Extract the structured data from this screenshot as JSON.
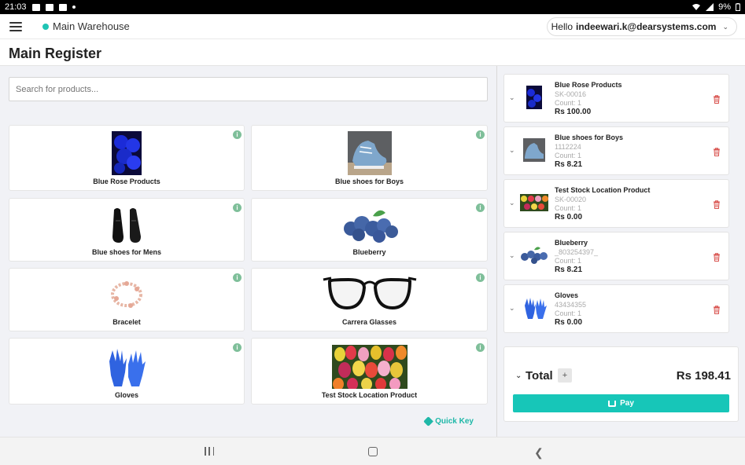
{
  "status_bar": {
    "time": "21:03",
    "battery": "9%"
  },
  "header": {
    "location": "Main Warehouse",
    "greeting": "Hello",
    "user": "indeewari.k@dearsystems.com"
  },
  "page": {
    "title": "Main Register"
  },
  "search": {
    "placeholder": "Search for products..."
  },
  "products": [
    {
      "name": "Blue Rose Products"
    },
    {
      "name": "Blue shoes for Boys"
    },
    {
      "name": "Blue shoes for Mens"
    },
    {
      "name": "Blueberry"
    },
    {
      "name": "Bracelet"
    },
    {
      "name": "Carrera Glasses"
    },
    {
      "name": "Gloves"
    },
    {
      "name": "Test Stock Location Product"
    }
  ],
  "quick_key": "Quick Key",
  "info_icon_glyph": "i",
  "cart": {
    "items": [
      {
        "name": "Blue Rose Products",
        "sku": "SK-00016",
        "count": "Count: 1",
        "price": "Rs 100.00"
      },
      {
        "name": "Blue shoes for Boys",
        "sku": "1112224",
        "count": "Count: 1",
        "price": "Rs 8.21"
      },
      {
        "name": "Test Stock Location Product",
        "sku": "SK-00020",
        "count": "Count: 1",
        "price": "Rs 0.00"
      },
      {
        "name": "Blueberry",
        "sku": "_803254397_",
        "count": "Count: 1",
        "price": "Rs 8.21"
      },
      {
        "name": "Gloves",
        "sku": "43434355",
        "count": "Count: 1",
        "price": "Rs 0.00"
      }
    ],
    "total_label": "Total",
    "total_plus": "+",
    "total_amount": "Rs 198.41",
    "pay_label": "Pay"
  },
  "colors": {
    "accent": "#17c6b8",
    "trash": "#d9534f",
    "info": "#7fbf9a"
  }
}
